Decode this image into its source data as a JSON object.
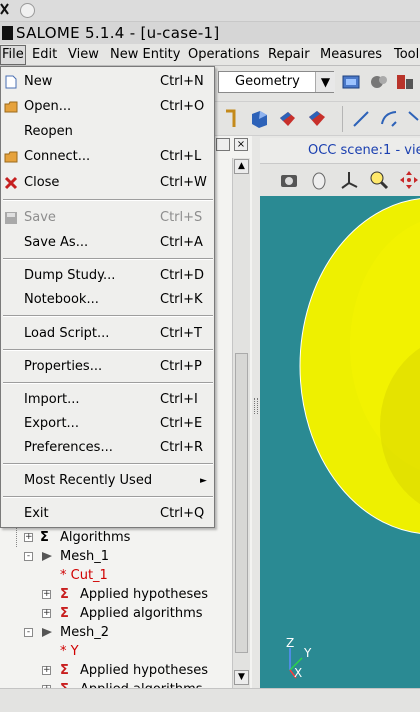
{
  "app": {
    "title": "SALOME 5.1.4 - [u-case-1]"
  },
  "menubar": {
    "items": [
      {
        "label": "File",
        "active": true
      },
      {
        "label": "Edit"
      },
      {
        "label": "View"
      },
      {
        "label": "New Entity"
      },
      {
        "label": "Operations"
      },
      {
        "label": "Repair"
      },
      {
        "label": "Measures"
      },
      {
        "label": "Tool"
      }
    ]
  },
  "toolbar": {
    "module_select": "Geometry"
  },
  "file_menu": {
    "items": [
      {
        "label": "New",
        "shortcut": "Ctrl+N",
        "icon": "new-document-icon"
      },
      {
        "label": "Open...",
        "shortcut": "Ctrl+O",
        "icon": "open-folder-icon"
      },
      {
        "label": "Reopen",
        "shortcut": ""
      },
      {
        "label": "Connect...",
        "shortcut": "Ctrl+L",
        "icon": "connect-folder-icon"
      },
      {
        "label": "Close",
        "shortcut": "Ctrl+W",
        "icon": "close-x-icon"
      },
      {
        "label": "Save",
        "shortcut": "Ctrl+S",
        "icon": "save-disk-icon",
        "disabled": true
      },
      {
        "label": "Save As...",
        "shortcut": "Ctrl+A"
      },
      {
        "label": "Dump Study...",
        "shortcut": "Ctrl+D"
      },
      {
        "label": "Notebook...",
        "shortcut": "Ctrl+K"
      },
      {
        "label": "Load Script...",
        "shortcut": "Ctrl+T"
      },
      {
        "label": "Properties...",
        "shortcut": "Ctrl+P"
      },
      {
        "label": "Import...",
        "shortcut": "Ctrl+I"
      },
      {
        "label": "Export...",
        "shortcut": "Ctrl+E"
      },
      {
        "label": "Preferences...",
        "shortcut": "Ctrl+R"
      },
      {
        "label": "Most Recently Used",
        "submenu": true
      },
      {
        "label": "Exit",
        "shortcut": "Ctrl+Q"
      }
    ]
  },
  "object_browser": {
    "rows": [
      {
        "label": "Algorithms",
        "indent": 1,
        "expander": "+",
        "icon": "sigma-icon"
      },
      {
        "label": "Mesh_1",
        "indent": 1,
        "expander": "-",
        "icon": "mesh-icon"
      },
      {
        "label": "* Cut_1",
        "indent": 2,
        "red": true
      },
      {
        "label": "Applied hypotheses",
        "indent": 2,
        "expander": "+",
        "icon": "sigma-icon"
      },
      {
        "label": "Applied algorithms",
        "indent": 2,
        "expander": "+",
        "icon": "sigma-icon"
      },
      {
        "label": "Mesh_2",
        "indent": 1,
        "expander": "-",
        "icon": "mesh-icon"
      },
      {
        "label": "* Y",
        "indent": 2,
        "red": true
      },
      {
        "label": "Applied hypotheses",
        "indent": 2,
        "expander": "+",
        "icon": "sigma-icon"
      },
      {
        "label": "Applied algorithms",
        "indent": 2,
        "expander": "+",
        "icon": "sigma-icon"
      }
    ]
  },
  "viewer": {
    "tab_label": "OCC scene:1 - vie",
    "axis_labels": {
      "z": "Z",
      "y": "Y",
      "x": "X"
    },
    "colors": {
      "background": "#2a8a93",
      "shape": "#f2f000"
    }
  }
}
